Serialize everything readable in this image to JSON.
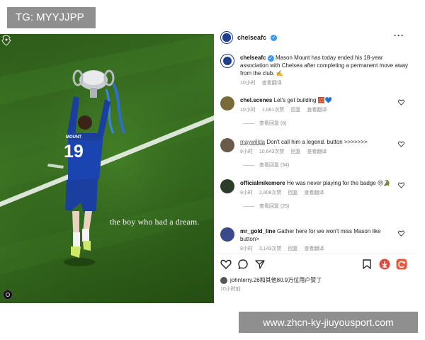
{
  "watermark": {
    "tag": "TG: MYYJJPP",
    "site": "www.zhcn-ky-jiuyousport.com"
  },
  "photo": {
    "caption": "the boy who had a dream.",
    "jersey_name": "MOUNT",
    "jersey_number": "19"
  },
  "post": {
    "account": "chelseafc",
    "author": "chelseafc",
    "text": "Mason Mount has today ended his 18-year association with Chelsea after completing a permanent move away from the club. ✍️",
    "time": "10小时",
    "translate": "查看翻译"
  },
  "comments": [
    {
      "user": "chel.scenes",
      "text": "Let's get building 🧱💙",
      "time": "10小时",
      "likes": "1,081次赞",
      "reply": "回复",
      "translate": "查看翻译",
      "replies": "查看回复 (6)",
      "avatar_color": "#7a6a3a"
    },
    {
      "user": "maywillda",
      "text": "Don't call him a legend. button >>>>>>>",
      "time": "9小时",
      "likes": "10,643次赞",
      "reply": "回复",
      "translate": "查看翻译",
      "replies": "查看回复 (34)",
      "avatar_color": "#6b5a4a"
    },
    {
      "user": "officialmikemore",
      "text": "He was never playing for the badge 😔🐊",
      "time": "9小时",
      "likes": "2,808次赞",
      "reply": "回复",
      "translate": "查看翻译",
      "replies": "查看回复 (25)",
      "avatar_color": "#2f3b2a"
    },
    {
      "user": "mr_gold_line",
      "text": "Gather here for we won't miss Mason like button>",
      "time": "9小时",
      "likes": "3,143次赞",
      "reply": "回复",
      "translate": "查看翻译",
      "avatar_color": "#3a4a8a"
    }
  ],
  "liked_by": {
    "user": "johnterry.26",
    "text": "johnterry.26和其他80.9万位用户赞了"
  },
  "footer_time": "10小时前",
  "colors": {
    "chelsea_blue": "#1f3f8f",
    "verified": "#3897f0",
    "meta_grey": "#8e8e8e",
    "watermark_grey": "#8f8f8f"
  }
}
